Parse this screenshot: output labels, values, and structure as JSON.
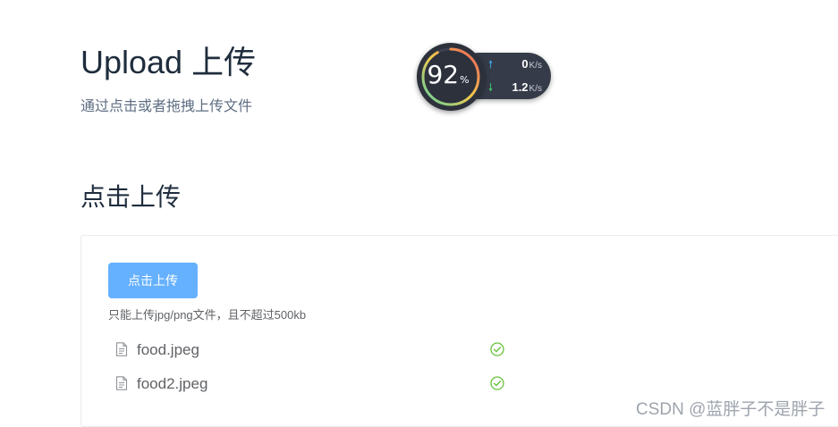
{
  "header": {
    "title": "Upload 上传",
    "subtitle": "通过点击或者拖拽上传文件"
  },
  "section": {
    "title": "点击上传"
  },
  "upload": {
    "button_label": "点击上传",
    "tip": "只能上传jpg/png文件，且不超过500kb",
    "files": [
      {
        "name": "food.jpeg",
        "status": "success"
      },
      {
        "name": "food2.jpeg",
        "status": "success"
      }
    ]
  },
  "speed_widget": {
    "percent": "92",
    "percent_unit": "%",
    "upload_speed": "0",
    "download_speed": "1.2",
    "speed_unit": "K/s"
  },
  "watermark": "CSDN @蓝胖子不是胖子",
  "colors": {
    "button": "#66b1ff",
    "success": "#67c23a",
    "title": "#1f2d3d",
    "subtitle": "#5e6d82"
  }
}
